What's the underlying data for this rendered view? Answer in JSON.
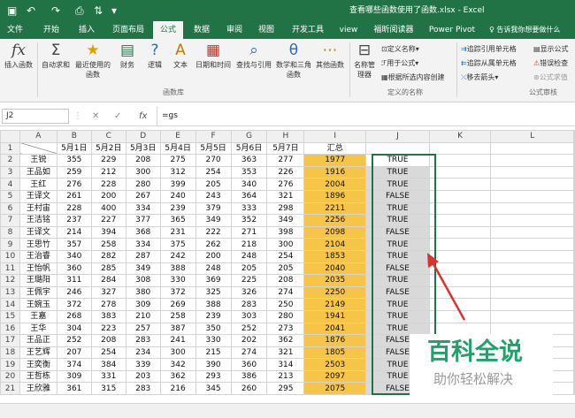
{
  "window": {
    "title": "查看哪些函数使用了函数.xlsx - Excel",
    "qa_icons": [
      "save-icon",
      "undo-icon",
      "redo-icon",
      "print-preview-icon",
      "sort-icon",
      "customize-icon"
    ]
  },
  "tabs": [
    "文件",
    "开始",
    "插入",
    "页面布局",
    "公式",
    "数据",
    "审阅",
    "视图",
    "开发工具",
    "view",
    "福昕阅读器",
    "Power Pivot"
  ],
  "active_tab": "公式",
  "tell_me": "♀ 告诉我你想要做什么",
  "ribbon": {
    "insert_function": "插入函数",
    "buttons": [
      "自动求和",
      "最近使用的函数",
      "财务",
      "逻辑",
      "文本",
      "日期和时间",
      "查找与引用",
      "数学和三角函数",
      "其他函数"
    ],
    "name_manager": "名称管理器",
    "define_name": "定义名称",
    "use_in_formula": "用于公式",
    "create_from_selection": "根据所选内容创建",
    "trace_precedents": "追踪引用单元格",
    "trace_dependents": "追踪从属单元格",
    "remove_arrows": "移去箭头",
    "show_formulas": "显示公式",
    "error_checking": "错误检查",
    "evaluate_formula": "公式求值",
    "group_library": "函数库",
    "group_names": "定义的名称",
    "group_audit": "公式审核"
  },
  "formula_bar": {
    "name_box": "J2",
    "cancel": "✕",
    "enter": "✓",
    "fx": "fx",
    "formula": "=gs"
  },
  "sheet": {
    "col_headers": [
      "A",
      "B",
      "C",
      "D",
      "E",
      "F",
      "G",
      "H",
      "I",
      "J",
      "K",
      "L"
    ],
    "header_row": [
      "",
      "5月1日",
      "5月2日",
      "5月3日",
      "5月4日",
      "5月5日",
      "5月6日",
      "5月7日",
      "汇总",
      "",
      "",
      ""
    ],
    "rows": [
      [
        "王锐",
        "355",
        "229",
        "208",
        "275",
        "270",
        "363",
        "277",
        "1977",
        "TRUE"
      ],
      [
        "王品如",
        "259",
        "212",
        "300",
        "312",
        "254",
        "353",
        "226",
        "1916",
        "TRUE"
      ],
      [
        "王红",
        "276",
        "228",
        "280",
        "399",
        "205",
        "340",
        "276",
        "2004",
        "TRUE"
      ],
      [
        "王译文",
        "261",
        "200",
        "267",
        "240",
        "243",
        "364",
        "321",
        "1896",
        "FALSE"
      ],
      [
        "王村宙",
        "228",
        "400",
        "334",
        "239",
        "379",
        "333",
        "298",
        "2211",
        "TRUE"
      ],
      [
        "王洁铭",
        "237",
        "227",
        "377",
        "365",
        "349",
        "352",
        "349",
        "2256",
        "TRUE"
      ],
      [
        "王译文",
        "214",
        "394",
        "368",
        "231",
        "222",
        "271",
        "398",
        "2098",
        "FALSE"
      ],
      [
        "王思竹",
        "357",
        "258",
        "334",
        "375",
        "262",
        "218",
        "300",
        "2104",
        "TRUE"
      ],
      [
        "王治睿",
        "340",
        "282",
        "287",
        "242",
        "200",
        "248",
        "254",
        "1853",
        "TRUE"
      ],
      [
        "王怡帆",
        "360",
        "285",
        "349",
        "388",
        "248",
        "205",
        "205",
        "2040",
        "FALSE"
      ],
      [
        "王璐阳",
        "311",
        "284",
        "308",
        "330",
        "369",
        "225",
        "208",
        "2035",
        "TRUE"
      ],
      [
        "王佩宇",
        "246",
        "327",
        "380",
        "372",
        "325",
        "326",
        "274",
        "2250",
        "FALSE"
      ],
      [
        "王婉玉",
        "372",
        "278",
        "309",
        "269",
        "388",
        "283",
        "250",
        "2149",
        "TRUE"
      ],
      [
        "王嘉",
        "268",
        "383",
        "210",
        "258",
        "239",
        "303",
        "280",
        "1941",
        "TRUE"
      ],
      [
        "王华",
        "304",
        "223",
        "257",
        "387",
        "350",
        "252",
        "273",
        "2041",
        "TRUE"
      ],
      [
        "王品正",
        "252",
        "208",
        "283",
        "241",
        "330",
        "202",
        "362",
        "1876",
        "FALSE"
      ],
      [
        "王艺辉",
        "207",
        "254",
        "234",
        "300",
        "215",
        "274",
        "321",
        "1805",
        "FALSE"
      ],
      [
        "王奕衡",
        "374",
        "384",
        "339",
        "342",
        "390",
        "360",
        "314",
        "2503",
        "TRUE"
      ],
      [
        "王哲栋",
        "309",
        "331",
        "203",
        "362",
        "293",
        "386",
        "213",
        "2097",
        "TRUE"
      ],
      [
        "王欣雅",
        "361",
        "315",
        "283",
        "216",
        "345",
        "260",
        "295",
        "2075",
        "FALSE"
      ]
    ]
  },
  "watermark": {
    "line1": "百科全说",
    "line2": "助你轻松解决"
  },
  "colors": {
    "excel_green": "#217346",
    "total_highlight": "#f6c548",
    "arrow_red": "#e03030",
    "watermark_green": "#1fa36b"
  }
}
